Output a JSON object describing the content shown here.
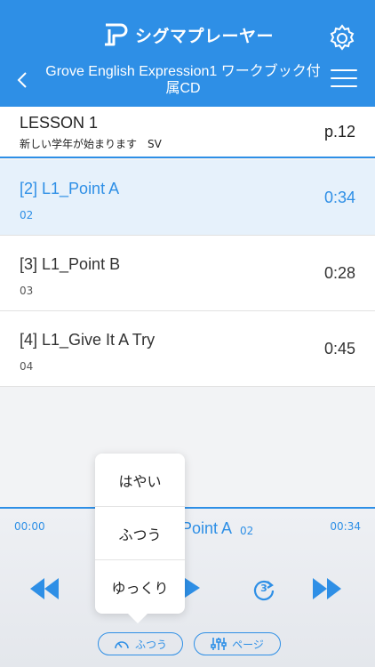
{
  "header": {
    "brand_name": "シグマプレーヤー",
    "nav_title": "Grove English Expression1 ワークブック付属CD",
    "colors": {
      "primary": "#2e8fe6"
    }
  },
  "lesson": {
    "title": "LESSON 1",
    "subtitle": "新しい学年が始まります　SV",
    "page": "p.12"
  },
  "tracks": [
    {
      "title": "[2] L1_Point A",
      "number": "02",
      "duration": "0:34",
      "active": true
    },
    {
      "title": "[3] L1_Point B",
      "number": "03",
      "duration": "0:28",
      "active": false
    },
    {
      "title": "[4] L1_Give It A Try",
      "number": "04",
      "duration": "0:45",
      "active": false
    }
  ],
  "player": {
    "elapsed": "00:00",
    "total": "00:34",
    "now_playing_title": "Point A",
    "now_playing_number": "02",
    "speed_label": "ふつう",
    "page_label": "ページ",
    "repeat_count": "3"
  },
  "speed_menu": {
    "options": [
      "はやい",
      "ふつう",
      "ゆっくり"
    ]
  }
}
